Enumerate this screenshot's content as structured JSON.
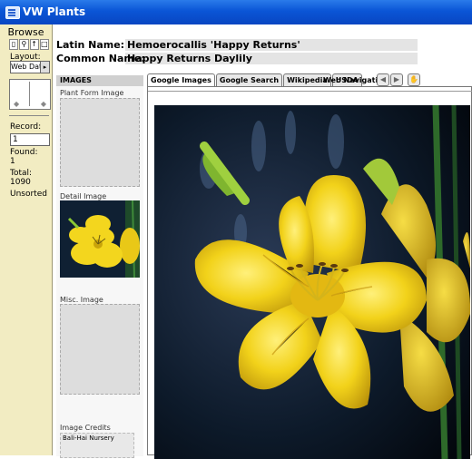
{
  "window": {
    "title": "VW Plants"
  },
  "status": {
    "mode": "Browse",
    "layout_label": "Layout:",
    "layout_value": "Web Dat",
    "record_label": "Record:",
    "record_value": "1",
    "found_label": "Found:",
    "found_value": "1",
    "total_label": "Total:",
    "total_value": "1090",
    "sort_state": "Unsorted"
  },
  "plant": {
    "latin_label": "Latin Name:",
    "latin_value": "Hemoerocallis 'Happy Returns'",
    "common_label": "Common Name:",
    "common_value": "Happy Returns Daylily"
  },
  "images": {
    "header": "IMAGES",
    "plant_form_label": "Plant Form Image",
    "detail_label": "Detail Image",
    "misc_label": "Misc. Image",
    "credits_label": "Image Credits",
    "credits_value": "Bali-Hai Nursery"
  },
  "tabs": [
    {
      "label": "Google Images"
    },
    {
      "label": "Google Search"
    },
    {
      "label": "Wikipedia"
    },
    {
      "label": "USDA"
    }
  ],
  "web_navigation_label": "Web Navigation",
  "icons": [
    "back-arrow-icon",
    "forward-arrow-icon",
    "hand-icon",
    "book-icon",
    "find-icon",
    "sort-icon",
    "new-record-icon"
  ],
  "colors": {
    "titlebar": "#0a55d6",
    "status_area": "#f2ecc2",
    "flower_yellow": "#f2d21a",
    "background_dark": "#1a2a3a"
  }
}
